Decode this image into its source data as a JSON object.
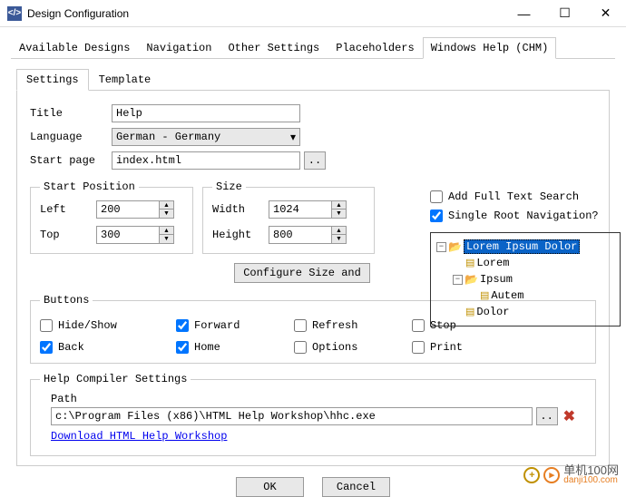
{
  "window": {
    "title": "Design Configuration"
  },
  "outer_tabs": [
    "Available Designs",
    "Navigation",
    "Other Settings",
    "Placeholders",
    "Windows Help (CHM)"
  ],
  "inner_tabs": [
    "Settings",
    "Template"
  ],
  "fields": {
    "title_lbl": "Title",
    "title_val": "Help",
    "lang_lbl": "Language",
    "lang_val": "German - Germany",
    "start_lbl": "Start page",
    "start_val": "index.html",
    "browse": ".."
  },
  "right_checks": {
    "fulltext": "Add Full Text Search",
    "fulltext_on": false,
    "singleroot": "Single Root Navigation?",
    "singleroot_on": true
  },
  "tree": {
    "root": "Lorem Ipsum Dolor",
    "n1": "Lorem",
    "n2": "Ipsum",
    "n2a": "Autem",
    "n3": "Dolor"
  },
  "startpos": {
    "legend": "Start Position",
    "left_lbl": "Left",
    "left_val": "200",
    "top_lbl": "Top",
    "top_val": "300"
  },
  "size": {
    "legend": "Size",
    "w_lbl": "Width",
    "w_val": "1024",
    "h_lbl": "Height",
    "h_val": "800",
    "cfg_btn": "Configure Size and"
  },
  "buttons_group": {
    "legend": "Buttons",
    "hide": "Hide/Show",
    "hide_on": false,
    "fwd": "Forward",
    "fwd_on": true,
    "refresh": "Refresh",
    "refresh_on": false,
    "stop": "Stop",
    "stop_on": false,
    "back": "Back",
    "back_on": true,
    "home": "Home",
    "home_on": true,
    "options": "Options",
    "options_on": false,
    "print": "Print",
    "print_on": false
  },
  "compiler": {
    "legend": "Help Compiler Settings",
    "path_lbl": "Path",
    "path_val": "c:\\Program Files (x86)\\HTML Help Workshop\\hhc.exe",
    "browse": "..",
    "link": "Download HTML Help Workshop"
  },
  "dialog": {
    "ok": "OK",
    "cancel": "Cancel"
  },
  "watermark": {
    "main": "单机100网",
    "sub": "danji100.com"
  }
}
